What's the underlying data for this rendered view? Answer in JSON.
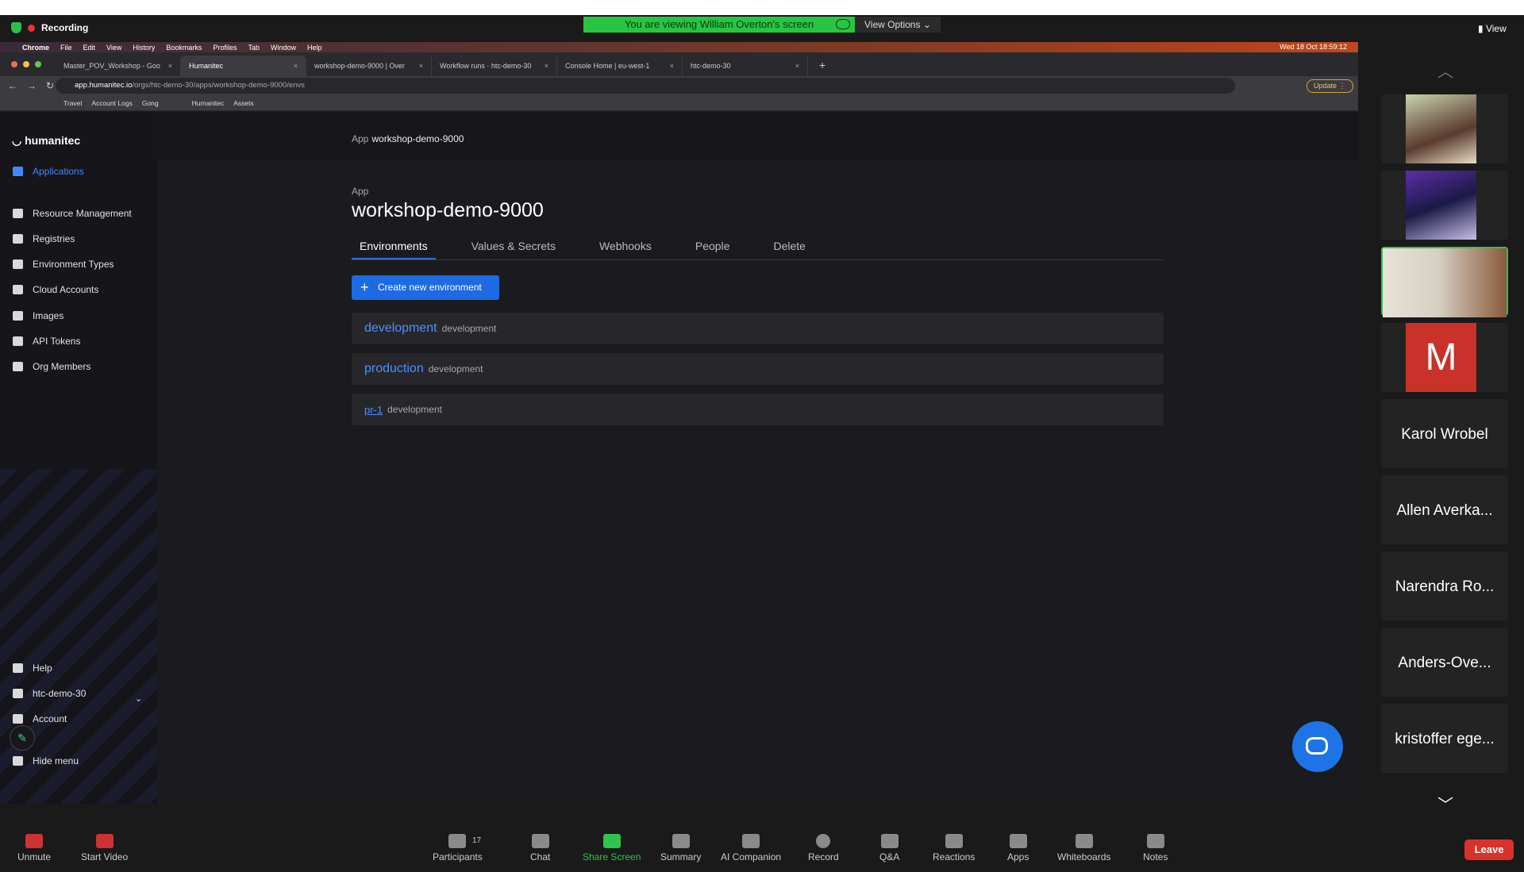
{
  "zoom": {
    "recording_label": "Recording",
    "viewing_banner": "You are viewing William Overton's screen",
    "view_options": "View Options",
    "view_label": "View",
    "bottom": [
      "Unmute",
      "Start Video",
      "Participants",
      "Chat",
      "Share Screen",
      "Summary",
      "AI Companion",
      "Record",
      "Q&A",
      "Reactions",
      "Apps",
      "Whiteboards",
      "Notes"
    ],
    "participants_count": "17",
    "leave_label": "Leave",
    "tiles": [
      "Karol Wrobel",
      "Allen Averka...",
      "Narendra Ro...",
      "Anders-Ove...",
      "kristoffer ege..."
    ],
    "m_tile_letter": "M"
  },
  "mac": {
    "menu": [
      "Chrome",
      "File",
      "Edit",
      "View",
      "History",
      "Bookmarks",
      "Profiles",
      "Tab",
      "Window",
      "Help"
    ],
    "clock": "Wed 18 Oct 18:59:12"
  },
  "browser": {
    "tabs": [
      "Master_POV_Workshop - Goo",
      "Humanitec",
      "workshop-demo-9000 | Over",
      "Workflow runs · htc-demo-30",
      "Console Home | eu-west-1",
      "htc-demo-30"
    ],
    "url_host": "app.humanitec.io",
    "url_path": "/orgs/htc-demo-30/apps/workshop-demo-9000/envs",
    "update_label": "Update",
    "bookmarks": [
      "Travel",
      "Account Logs",
      "Gong",
      "Humanitec",
      "Assets"
    ]
  },
  "sidebar": {
    "logo": "humanitec",
    "items": [
      "Applications",
      "Resource Management",
      "Registries",
      "Environment Types",
      "Cloud Accounts",
      "Images",
      "API Tokens",
      "Org Members"
    ],
    "bottom": [
      "Help",
      "htc-demo-30",
      "Account",
      "Hide menu"
    ]
  },
  "main": {
    "crumb_label": "App",
    "crumb_value": "workshop-demo-9000",
    "sub_label": "App",
    "title": "workshop-demo-9000",
    "tabs": [
      "Environments",
      "Values & Secrets",
      "Webhooks",
      "People",
      "Delete"
    ],
    "create_button": "Create new environment",
    "envs": [
      {
        "name": "development",
        "type": "development"
      },
      {
        "name": "production",
        "type": "development"
      },
      {
        "name": "pr-1",
        "type": "development"
      }
    ]
  }
}
